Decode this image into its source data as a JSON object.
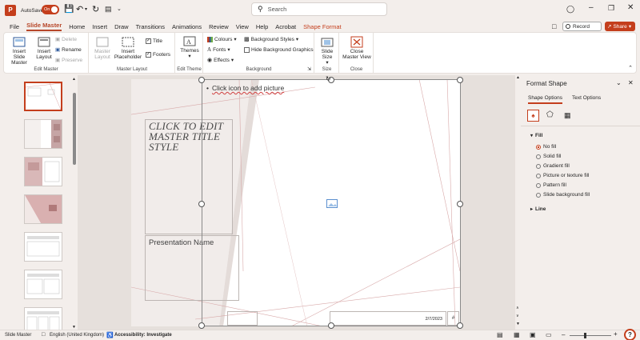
{
  "titlebar": {
    "autosave_label": "AutoSave",
    "autosave_state": "On",
    "search_placeholder": "Search",
    "record_label": "Record",
    "share_label": "Share"
  },
  "menu": {
    "tabs": [
      "File",
      "Slide Master",
      "Home",
      "Insert",
      "Draw",
      "Transitions",
      "Animations",
      "Review",
      "View",
      "Help",
      "Acrobat",
      "Shape Format"
    ]
  },
  "ribbon": {
    "edit_master": {
      "insert_slide_master": "Insert Slide Master",
      "insert_layout": "Insert Layout",
      "delete": "Delete",
      "rename": "Rename",
      "preserve": "Preserve",
      "group": "Edit Master"
    },
    "master_layout": {
      "master_layout": "Master Layout",
      "insert_placeholder": "Insert Placeholder",
      "title": "Title",
      "footers": "Footers",
      "group": "Master Layout"
    },
    "edit_theme": {
      "themes": "Themes",
      "group": "Edit Theme"
    },
    "background": {
      "colours": "Colours",
      "fonts": "Fonts",
      "effects": "Effects",
      "background_styles": "Background Styles",
      "hide_bg": "Hide Background Graphics",
      "group": "Background"
    },
    "size": {
      "slide_size": "Slide Size",
      "group": "Size"
    },
    "close": {
      "close_master": "Close Master View",
      "group": "Close"
    }
  },
  "slide": {
    "picture_prompt": "Click icon to add picture",
    "title_placeholder": "CLICK TO EDIT MASTER TITLE STYLE",
    "subtitle_placeholder": "Presentation Name",
    "date": "2/7/2023",
    "page_symbol": "#"
  },
  "thumbnails": {
    "count": 7,
    "selected_index": 0
  },
  "pane": {
    "title": "Format Shape",
    "tabs": [
      "Shape Options",
      "Text Options"
    ],
    "fill_label": "Fill",
    "fill_options": [
      "No fill",
      "Solid fill",
      "Gradient fill",
      "Picture or texture fill",
      "Pattern fill",
      "Slide background fill"
    ],
    "selected_fill": 0,
    "line_label": "Line"
  },
  "status": {
    "view": "Slide Master",
    "language": "English (United Kingdom)",
    "accessibility": "Accessibility: Investigate"
  },
  "colors": {
    "accent": "#c43e1c",
    "brand": "#b7472a"
  }
}
